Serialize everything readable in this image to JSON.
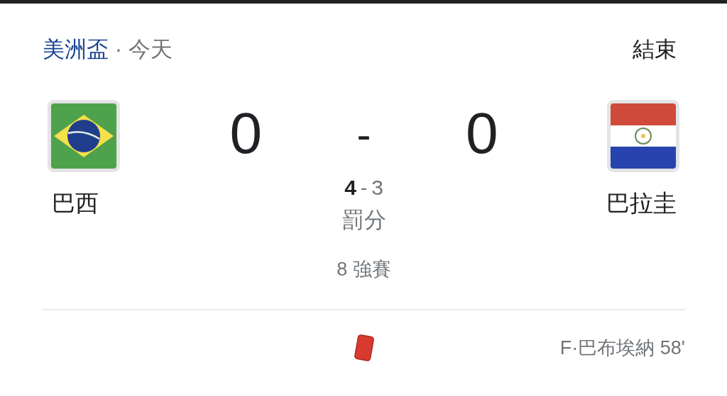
{
  "header": {
    "competition": "美洲盃",
    "separator": "·",
    "date": "今天",
    "status": "結束"
  },
  "home": {
    "name": "巴西",
    "kind": "brazil",
    "score": "0",
    "penalties": "4",
    "winner": true
  },
  "score_separator": "-",
  "away": {
    "name": "巴拉圭",
    "kind": "paraguay",
    "score": "0",
    "penalties": "3",
    "winner": false
  },
  "penalty_separator": "-",
  "penalty_label": "罰分",
  "stage": "8 強賽",
  "events": [
    {
      "kind": "red_card",
      "text": "F·巴布埃納 58'"
    }
  ]
}
